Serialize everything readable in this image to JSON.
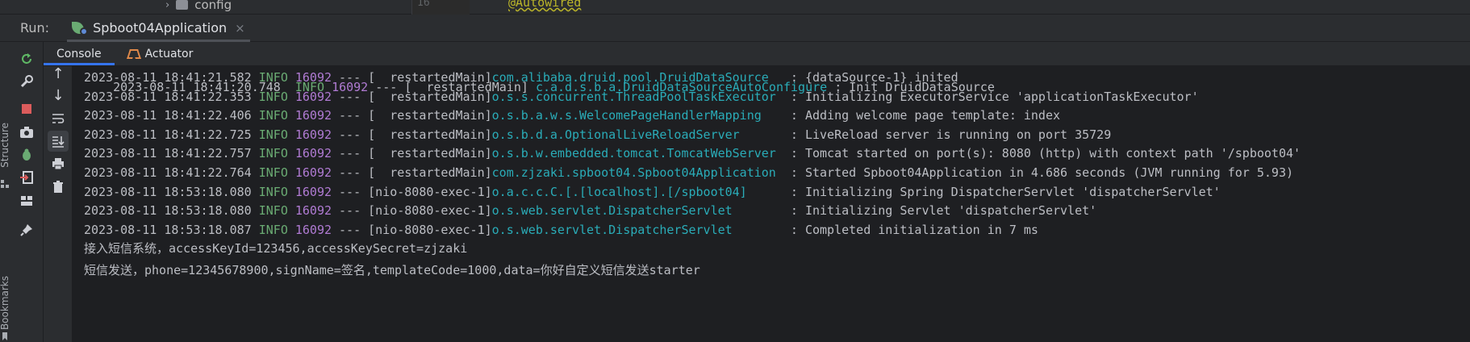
{
  "top": {
    "tree_item": "config",
    "gutter_line": "16",
    "editor_annotation": "@Autowired"
  },
  "run_panel": {
    "label": "Run:",
    "config_name": "Spboot04Application",
    "close_glyph": "×"
  },
  "side_strip": {
    "structure_label": "Structure",
    "bookmarks_label": "Bookmarks"
  },
  "tabs": [
    {
      "label": "Console"
    },
    {
      "label": "Actuator"
    }
  ],
  "log_lines": [
    {
      "ts": "2023-08-11 18:41:21.582",
      "level": "INFO",
      "pid": "16092",
      "sep": "---",
      "thread": "[  restartedMain]",
      "logger": "com.alibaba.druid.pool.DruidDataSource",
      "msg": ": {dataSource-1} inited"
    },
    {
      "ts": "2023-08-11 18:41:22.353",
      "level": "INFO",
      "pid": "16092",
      "sep": "---",
      "thread": "[  restartedMain]",
      "logger": "o.s.s.concurrent.ThreadPoolTaskExecutor",
      "msg": ": Initializing ExecutorService 'applicationTaskExecutor'"
    },
    {
      "ts": "2023-08-11 18:41:22.406",
      "level": "INFO",
      "pid": "16092",
      "sep": "---",
      "thread": "[  restartedMain]",
      "logger": "o.s.b.a.w.s.WelcomePageHandlerMapping",
      "msg": ": Adding welcome page template: index"
    },
    {
      "ts": "2023-08-11 18:41:22.725",
      "level": "INFO",
      "pid": "16092",
      "sep": "---",
      "thread": "[  restartedMain]",
      "logger": "o.s.b.d.a.OptionalLiveReloadServer",
      "msg": ": LiveReload server is running on port 35729"
    },
    {
      "ts": "2023-08-11 18:41:22.757",
      "level": "INFO",
      "pid": "16092",
      "sep": "---",
      "thread": "[  restartedMain]",
      "logger": "o.s.b.w.embedded.tomcat.TomcatWebServer",
      "msg": ": Tomcat started on port(s): 8080 (http) with context path '/spboot04'"
    },
    {
      "ts": "2023-08-11 18:41:22.764",
      "level": "INFO",
      "pid": "16092",
      "sep": "---",
      "thread": "[  restartedMain]",
      "logger": "com.zjzaki.spboot04.Spboot04Application",
      "msg": ": Started Spboot04Application in 4.686 seconds (JVM running for 5.93)"
    },
    {
      "ts": "2023-08-11 18:53:18.080",
      "level": "INFO",
      "pid": "16092",
      "sep": "---",
      "thread": "[nio-8080-exec-1]",
      "logger": "o.a.c.c.C.[.[localhost].[/spboot04]",
      "msg": ": Initializing Spring DispatcherServlet 'dispatcherServlet'"
    },
    {
      "ts": "2023-08-11 18:53:18.080",
      "level": "INFO",
      "pid": "16092",
      "sep": "---",
      "thread": "[nio-8080-exec-1]",
      "logger": "o.s.web.servlet.DispatcherServlet",
      "msg": ": Initializing Servlet 'dispatcherServlet'"
    },
    {
      "ts": "2023-08-11 18:53:18.087",
      "level": "INFO",
      "pid": "16092",
      "sep": "---",
      "thread": "[nio-8080-exec-1]",
      "logger": "o.s.web.servlet.DispatcherServlet",
      "msg": ": Completed initialization in 7 ms"
    }
  ],
  "plain_lines": [
    "接入短信系统，accessKeyId=123456,accessKeySecret=zjzaki",
    "短信发送，phone=12345678900,signName=签名,templateCode=1000,data=你好自定义短信发送starter"
  ],
  "colors": {
    "timestamp": "#bcbec4",
    "level": "#6aab73",
    "pid": "#b07bd3",
    "logger": "#2aacb8",
    "console_bg": "#1e1f22",
    "panel_bg": "#2b2d30",
    "tab_underline": "#3574f0"
  }
}
